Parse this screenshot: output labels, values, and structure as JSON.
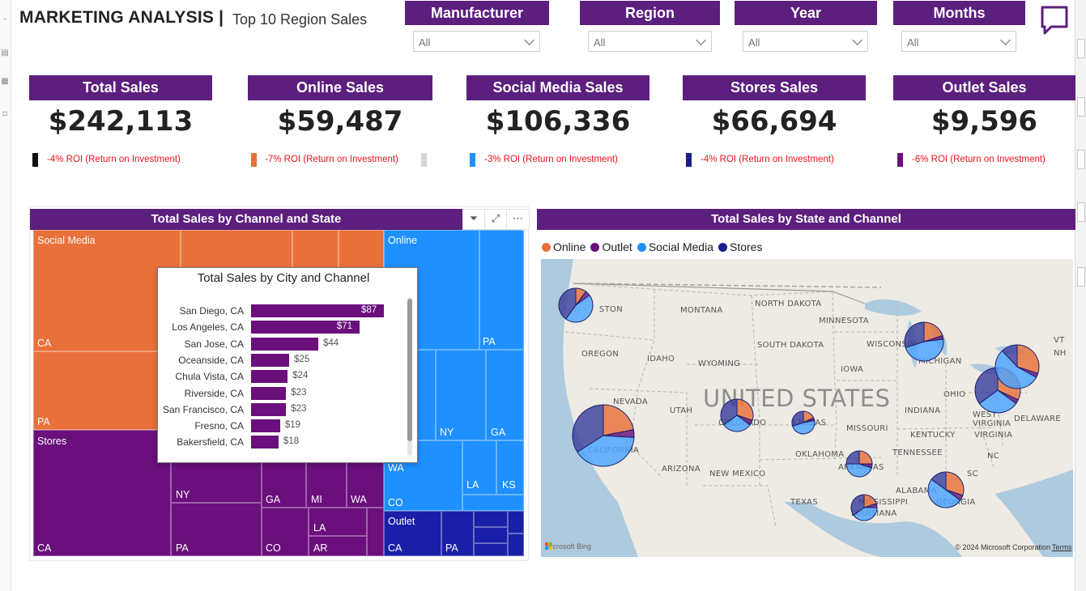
{
  "header": {
    "title": "MARKETING ANALYSIS |",
    "subtitle": "Top 10 Region Sales"
  },
  "slicers": [
    {
      "label": "Manufacturer",
      "value": "All"
    },
    {
      "label": "Region",
      "value": "All"
    },
    {
      "label": "Year",
      "value": "All"
    },
    {
      "label": "Months",
      "value": "All"
    }
  ],
  "kpis": [
    {
      "label": "Total Sales",
      "value": "$242,113",
      "roi": "-4% ROI (Return on Investment)",
      "marker_color": "#111111"
    },
    {
      "label": "Online Sales",
      "value": "$59,487",
      "roi": "-7% ROI (Return on Investment)",
      "marker_color": "#e8703a"
    },
    {
      "label": "Social Media Sales",
      "value": "$106,336",
      "roi": "-3% ROI (Return on Investment)",
      "marker_color": "#1e90ff"
    },
    {
      "label": "Stores Sales",
      "value": "$66,694",
      "roi": "-4% ROI (Return on Investment)",
      "marker_color": "#1a1f8c"
    },
    {
      "label": "Outlet Sales",
      "value": "$9,596",
      "roi": "-6% ROI (Return on Investment)",
      "marker_color": "#6a0f7c"
    }
  ],
  "treemap": {
    "title": "Total Sales by Channel and State",
    "icons": [
      "filter-icon",
      "focus-mode-icon",
      "more-options-icon"
    ],
    "colors": {
      "Social Media": "#e8703a",
      "Online": "#1e90ff",
      "Stores": "#6a0f7c",
      "Outlet": "#1a1fa8"
    },
    "group_labels": {
      "social_media": "Social Media",
      "online": "Online",
      "stores": "Stores",
      "outlet": "Outlet"
    },
    "state_labels": {
      "sm_ca": "CA",
      "sm_pa": "PA",
      "on_pa": "PA",
      "on_ny": "NY",
      "on_ga": "GA",
      "on_wa": "WA",
      "on_la": "LA",
      "on_ks": "KS",
      "on_co": "CO",
      "st_ca": "CA",
      "st_ny": "NY",
      "st_pa": "PA",
      "st_ga": "GA",
      "st_mi": "MI",
      "st_wa": "WA",
      "st_co": "CO",
      "st_la": "LA",
      "st_ar": "AR",
      "ou_ca": "CA",
      "ou_pa": "PA"
    }
  },
  "tooltip": {
    "title": "Total Sales by City and Channel",
    "bar_color": "#6a0f7c",
    "rows": [
      {
        "city": "San Diego, CA",
        "value": 87,
        "label": "$87"
      },
      {
        "city": "Los Angeles, CA",
        "value": 71,
        "label": "$71"
      },
      {
        "city": "San Jose, CA",
        "value": 44,
        "label": "$44"
      },
      {
        "city": "Oceanside, CA",
        "value": 25,
        "label": "$25"
      },
      {
        "city": "Chula Vista, CA",
        "value": 24,
        "label": "$24"
      },
      {
        "city": "Riverside, CA",
        "value": 23,
        "label": "$23"
      },
      {
        "city": "San Francisco, CA",
        "value": 23,
        "label": "$23"
      },
      {
        "city": "Fresno, CA",
        "value": 19,
        "label": "$19"
      },
      {
        "city": "Bakersfield, CA",
        "value": 18,
        "label": "$18"
      }
    ]
  },
  "map_visual": {
    "title": "Total Sales by State and Channel",
    "legend": [
      {
        "name": "Online",
        "color": "#e8703a"
      },
      {
        "name": "Outlet",
        "color": "#6a0f7c"
      },
      {
        "name": "Social Media",
        "color": "#1e90ff"
      },
      {
        "name": "Stores",
        "color": "#1a1f8c"
      }
    ],
    "country_label": "UNITED STATES",
    "place_labels": [
      "MONTANA",
      "NORTH DAKOTA",
      "MINNESOTA",
      "OREGON",
      "IDAHO",
      "SOUTH DAKOTA",
      "WISCONSIN",
      "WYOMING",
      "IOWA",
      "MICHIGAN",
      "NEVADA",
      "OHIO",
      "UTAH",
      "INDIANA",
      "WEST VIRGINIA",
      "DELAWARE",
      "CALIFORNIA",
      "COLORADO",
      "KANSAS",
      "MISSOURI",
      "KENTUCKY",
      "VIRGINIA",
      "TENNESSEE",
      "NC",
      "OKLAHOMA",
      "ARIZONA",
      "NEW MEXICO",
      "ARKANSAS",
      "SC",
      "ALABAMA",
      "GEORGIA",
      "MISSISSIPPI",
      "TEXAS",
      "LOUISIANA",
      "STON",
      "VT",
      "NH"
    ],
    "attribution": "Microsoft Bing",
    "copyright": "© 2024 Microsoft Corporation",
    "terms": "Terms",
    "pies": [
      {
        "state": "WA",
        "online": 0.1,
        "outlet": 0.05,
        "social": 0.45,
        "stores": 0.4
      },
      {
        "state": "CA",
        "online": 0.22,
        "outlet": 0.04,
        "social": 0.4,
        "stores": 0.34
      },
      {
        "state": "CO",
        "online": 0.3,
        "outlet": 0.05,
        "social": 0.3,
        "stores": 0.35
      },
      {
        "state": "KS",
        "online": 0.18,
        "outlet": 0.04,
        "social": 0.48,
        "stores": 0.3
      },
      {
        "state": "AR",
        "online": 0.25,
        "outlet": 0.05,
        "social": 0.45,
        "stores": 0.25
      },
      {
        "state": "LA",
        "online": 0.2,
        "outlet": 0.05,
        "social": 0.4,
        "stores": 0.35
      },
      {
        "state": "GA",
        "online": 0.3,
        "outlet": 0.05,
        "social": 0.5,
        "stores": 0.15
      },
      {
        "state": "MI",
        "online": 0.2,
        "outlet": 0.03,
        "social": 0.47,
        "stores": 0.3
      },
      {
        "state": "PA",
        "online": 0.32,
        "outlet": 0.03,
        "social": 0.3,
        "stores": 0.35
      },
      {
        "state": "NY",
        "online": 0.3,
        "outlet": 0.03,
        "social": 0.55,
        "stores": 0.12
      }
    ]
  }
}
